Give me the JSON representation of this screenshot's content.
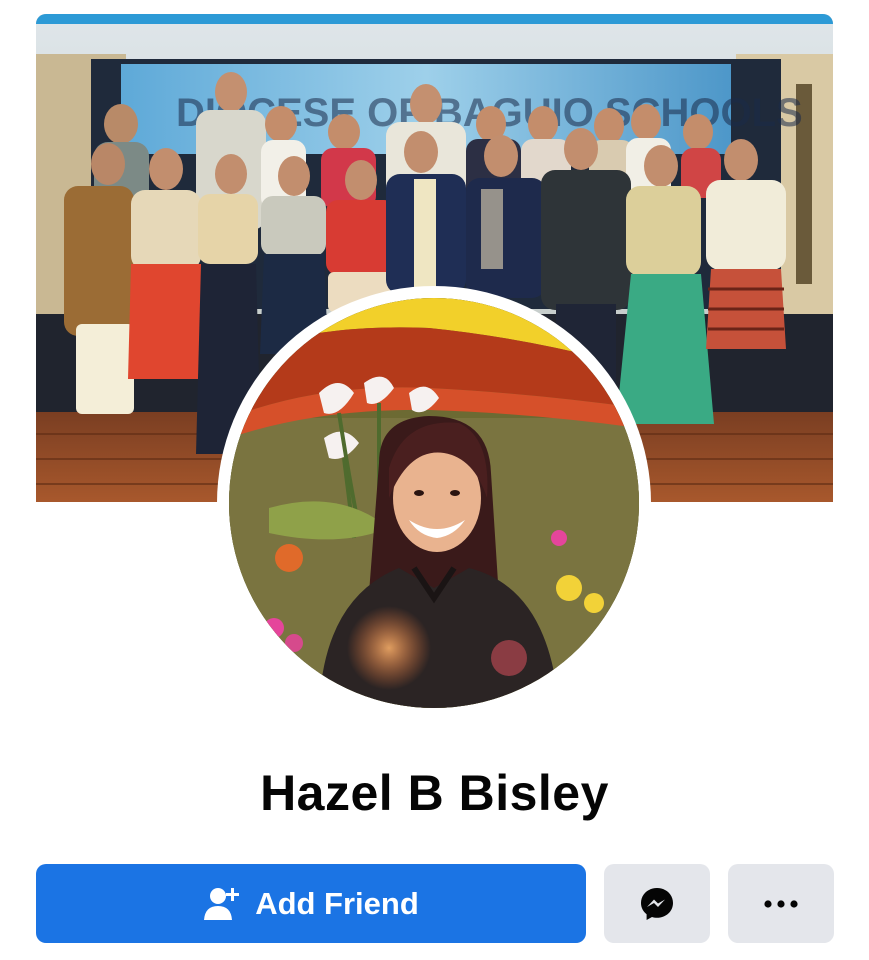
{
  "profile": {
    "name": "Hazel B Bisley"
  },
  "cover": {
    "banner_text": "DIOCESE OF BAGUIO SCHOOLS"
  },
  "actions": {
    "add_friend_label": "Add Friend",
    "add_friend_icon": "add-person-icon",
    "messenger_icon": "messenger-icon",
    "more_icon": "more-options-icon"
  },
  "colors": {
    "primary_button": "#1b74e4",
    "secondary_button": "#e4e6eb",
    "name_text": "#050505"
  }
}
